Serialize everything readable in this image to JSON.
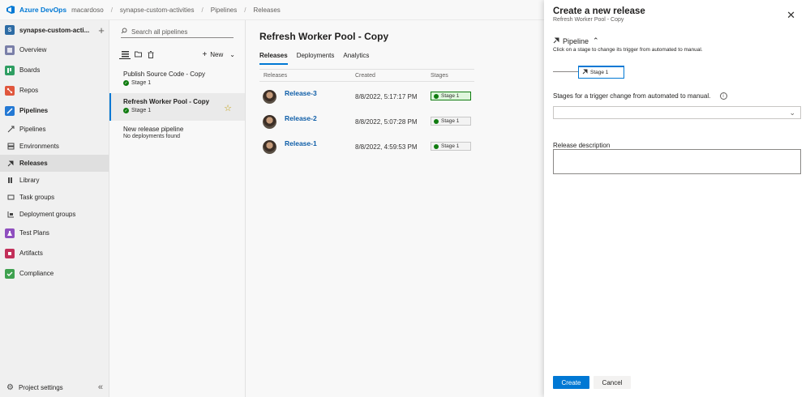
{
  "topbar": {
    "org": "Azure DevOps",
    "breadcrumbs": [
      "macardoso",
      "synapse-custom-activities",
      "Pipelines",
      "Releases"
    ]
  },
  "project": {
    "badge": "S",
    "name": "synapse-custom-acti..."
  },
  "nav": {
    "overview": "Overview",
    "boards": "Boards",
    "repos": "Repos",
    "pipelines": "Pipelines",
    "sub_pipelines": "Pipelines",
    "environments": "Environments",
    "releases": "Releases",
    "library": "Library",
    "task_groups": "Task groups",
    "deployment_groups": "Deployment groups",
    "test_plans": "Test Plans",
    "artifacts": "Artifacts",
    "compliance": "Compliance",
    "project_settings": "Project settings"
  },
  "pipelines_pane": {
    "search_placeholder": "Search all pipelines",
    "new_label": "New",
    "items": [
      {
        "name": "Publish Source Code - Copy",
        "stage": "Stage 1"
      },
      {
        "name": "Refresh Worker Pool - Copy",
        "stage": "Stage 1"
      },
      {
        "name": "New release pipeline",
        "stage": "No deployments found"
      }
    ]
  },
  "main": {
    "title": "Refresh Worker Pool - Copy",
    "tabs": [
      "Releases",
      "Deployments",
      "Analytics"
    ],
    "columns": [
      "Releases",
      "Created",
      "Stages"
    ],
    "rows": [
      {
        "name": "Release-3",
        "created": "8/8/2022, 5:17:17 PM",
        "stage": "Stage 1"
      },
      {
        "name": "Release-2",
        "created": "8/8/2022, 5:07:28 PM",
        "stage": "Stage 1"
      },
      {
        "name": "Release-1",
        "created": "8/8/2022, 4:59:53 PM",
        "stage": "Stage 1"
      }
    ]
  },
  "panel": {
    "title": "Create a new release",
    "subtitle": "Refresh Worker Pool - Copy",
    "pipeline_heading": "Pipeline",
    "pipeline_hint": "Click on a stage to change its trigger from automated to manual.",
    "stage_box": "Stage 1",
    "manual_stages_label": "Stages for a trigger change from automated to manual.",
    "release_description_label": "Release description",
    "create_label": "Create",
    "cancel_label": "Cancel"
  },
  "colors": {
    "accent": "#0078d4",
    "success": "#107c10"
  }
}
